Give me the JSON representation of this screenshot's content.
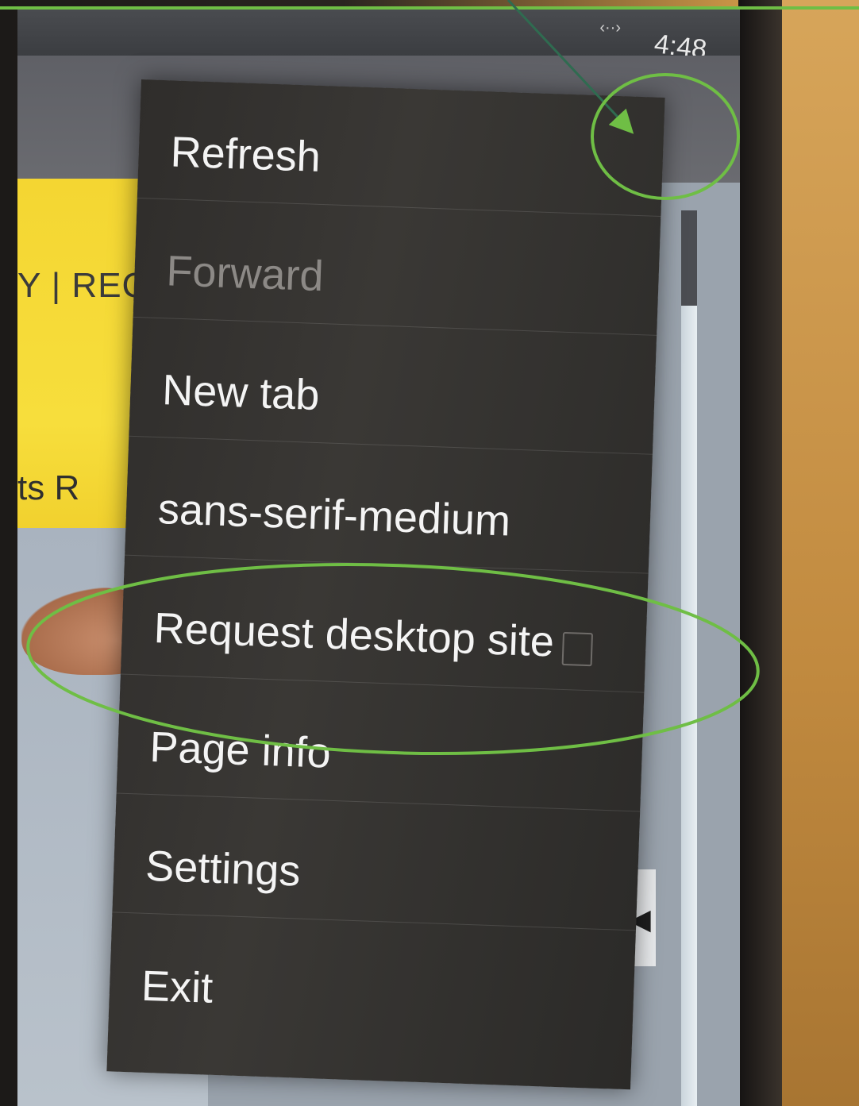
{
  "status_bar": {
    "time": "4:48",
    "signal_glyph": "‹··›"
  },
  "background_page": {
    "text_row_1": "Y | REC",
    "text_row_2": "ts  R"
  },
  "menu": {
    "items": [
      {
        "label": "Refresh",
        "enabled": true
      },
      {
        "label": "Forward",
        "enabled": false
      },
      {
        "label": "New tab",
        "enabled": true
      },
      {
        "label": "sans-serif-medium",
        "enabled": true
      },
      {
        "label": "Request desktop site",
        "enabled": true,
        "checkbox": true,
        "checked": false
      },
      {
        "label": "Page info",
        "enabled": true
      },
      {
        "label": "Settings",
        "enabled": true
      },
      {
        "label": "Exit",
        "enabled": true
      }
    ]
  },
  "icons": {
    "overflow_menu": "kebab-icon",
    "side_handle": "triangle-left-icon"
  },
  "annotation_color": "#6fbe45"
}
